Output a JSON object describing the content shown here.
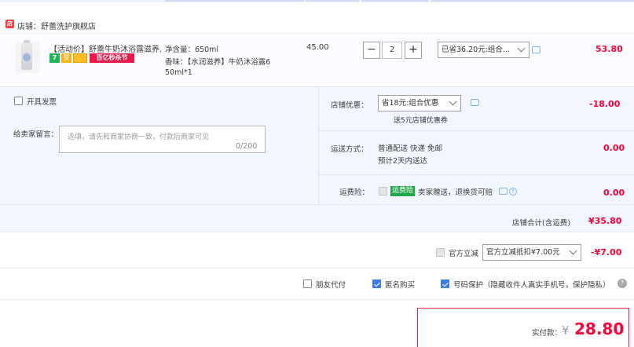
{
  "store": {
    "icon": "store-icon",
    "label": "店铺：舒蕾洗护旗舰店"
  },
  "item": {
    "title": "【活动价】舒蕾牛奶沐浴露滋养...",
    "badges": {
      "seven_day": "7",
      "quality": "赞",
      "promo": "百亿秒杀节"
    },
    "spec_net_label": "净含量：",
    "spec_net_value": "650ml",
    "spec_scent_line1": "香味：【水润滋养】牛奶沐浴露6",
    "spec_scent_line2": "50ml*1",
    "unit_price": "45.00",
    "quantity": "2",
    "qty_minus": "−",
    "qty_plus": "+",
    "discount_select": "已省36.20元:组合...",
    "total": "53.80"
  },
  "invoice": {
    "label": "开具发票",
    "checked": false
  },
  "message": {
    "label": "给卖家留言：",
    "placeholder": "选填，请先和商家协商一致，付款后商家可见",
    "count": "0/200"
  },
  "store_discount": {
    "label": "店铺优惠：",
    "select": "省18元:组合优惠",
    "note": "送5元店铺优惠券",
    "amount": "-18.00"
  },
  "shipping": {
    "label": "运送方式：",
    "line1": "普通配送 快递 免邮",
    "line2": "预计2天内送达",
    "amount": "0.00"
  },
  "freight_insurance": {
    "label": "运费险：",
    "tag": "运费险",
    "text": "卖家赠送，退换货可赔",
    "amount": "0.00"
  },
  "store_total": {
    "label": "店铺合计(含运费)",
    "value": "¥35.80"
  },
  "official_discount": {
    "label": "官方立减",
    "select": "官方立减抵扣¥7.00元",
    "amount": "-¥7.00"
  },
  "options": {
    "friend_pay": "朋友代付",
    "anonymous": "匿名购买",
    "privacy": "号码保护（隐藏收件人真实手机号，保护隐私）",
    "help": "?"
  },
  "payment": {
    "label": "实付款：",
    "currency": "¥",
    "amount": "28.80"
  },
  "colors": {
    "accent_red": "#ff0036",
    "checkbox_blue": "#3a7be6",
    "panel_bg": "#f2f7ff",
    "tag_green": "#22a84a"
  }
}
